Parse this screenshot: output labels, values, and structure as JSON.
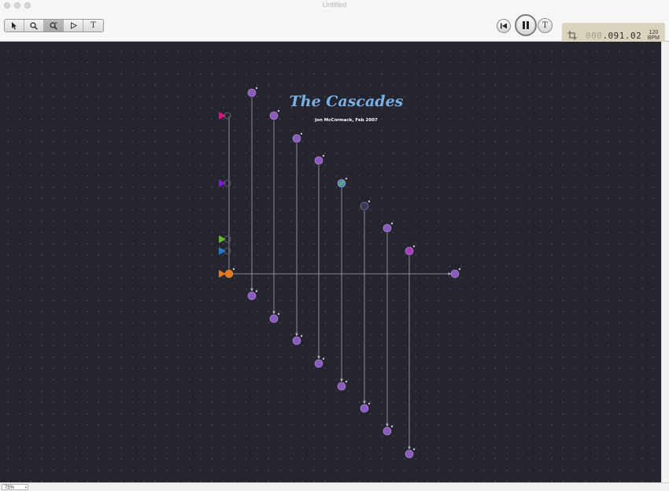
{
  "window": {
    "title": "Untitled"
  },
  "tools": [
    {
      "name": "select-tool",
      "icon": "arrow-pointer-icon"
    },
    {
      "name": "zoom-tool",
      "icon": "magnifier-icon"
    },
    {
      "name": "cell-tool",
      "icon": "cell-magnifier-icon"
    },
    {
      "name": "play-tool",
      "icon": "play-outline-icon"
    },
    {
      "name": "text-tool",
      "icon": "T"
    }
  ],
  "transport": {
    "rewind_icon": "rewind-icon",
    "pause_icon": "pause-icon",
    "tempo_button_label": "T",
    "counter_prefix": "000",
    "counter_value": ".091.02",
    "bpm_value": "120",
    "bpm_label": "BPM"
  },
  "canvas": {
    "title": "The Cascades",
    "subtitle": "Jon McCormack, Feb 2007"
  },
  "status": {
    "zoom_value": "75%"
  },
  "colors": {
    "canvas_bg": "#25252f",
    "cell": "#8c5bbd",
    "generator_pink": "#d1147e",
    "generator_purple": "#7a1bd1",
    "generator_green": "#66b82a",
    "generator_blue": "#1f7acd",
    "generator_orange": "#e37a1e",
    "title_blue": "#7ab0e8"
  }
}
